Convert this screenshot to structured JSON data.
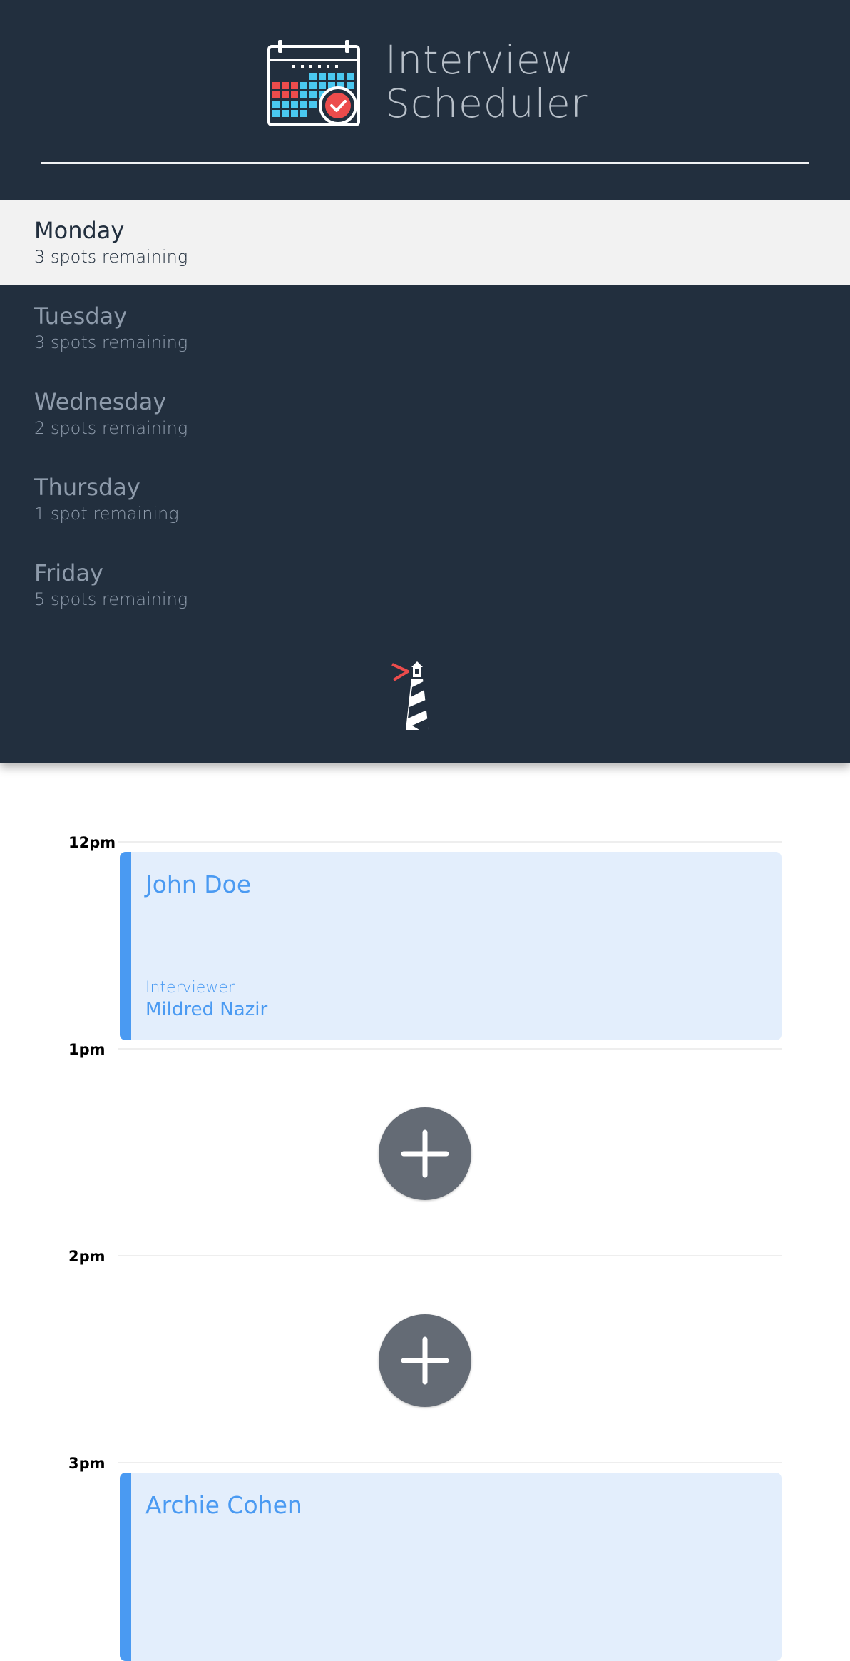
{
  "brand": {
    "title_line1": "Interview",
    "title_line2": "Scheduler",
    "logo": "calendar-check-icon"
  },
  "days": [
    {
      "name": "Monday",
      "spots": "3 spots remaining",
      "selected": true
    },
    {
      "name": "Tuesday",
      "spots": "3 spots remaining",
      "selected": false
    },
    {
      "name": "Wednesday",
      "spots": "2 spots remaining",
      "selected": false
    },
    {
      "name": "Thursday",
      "spots": "1 spot remaining",
      "selected": false
    },
    {
      "name": "Friday",
      "spots": "5 spots remaining",
      "selected": false
    }
  ],
  "footer_logo": "lighthouse-icon",
  "schedule": {
    "times": [
      "12pm",
      "1pm",
      "2pm",
      "3pm"
    ],
    "appointments": [
      {
        "student": "John Doe",
        "interviewer_label": "Interviewer",
        "interviewer": "Mildred Nazir"
      },
      {
        "student": "Archie Cohen"
      }
    ],
    "add_icon": "plus-icon"
  },
  "colors": {
    "sidebar_bg": "#222f3e",
    "selected_day_bg": "#f2f2f2",
    "appointment_accent": "#4a9af2",
    "appointment_bg": "#e3eefc",
    "add_button": "#646b75",
    "logo_red": "#ec4c4c",
    "logo_blue": "#4ac8f0"
  }
}
